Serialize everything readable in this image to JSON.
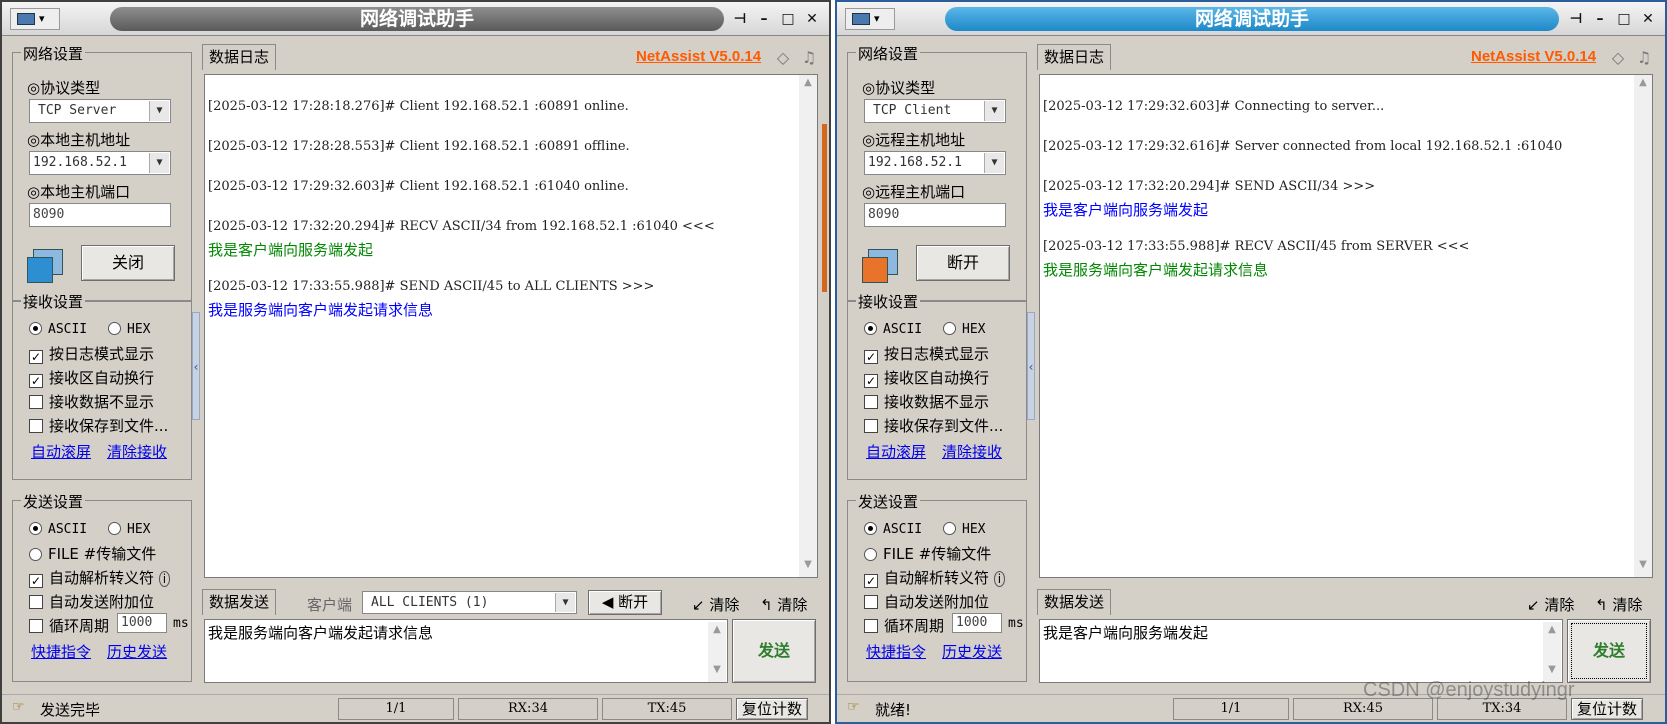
{
  "watermark": "CSDN @enjoystudyingr",
  "windows": [
    {
      "title": "网络调试助手",
      "network": {
        "group_title": "网络设置",
        "protocol_label": "◎协议类型",
        "protocol_value": "TCP Server",
        "host_label": "◎本地主机地址",
        "host_value": "192.168.52.1",
        "port_label": "◎本地主机端口",
        "port_value": "8090",
        "action_button": "关闭"
      },
      "receive": {
        "group_title": "接收设置",
        "ascii": "ASCII",
        "hex": "HEX",
        "opt1": "按日志模式显示",
        "opt2": "接收区自动换行",
        "opt3": "接收数据不显示",
        "opt4": "接收保存到文件...",
        "link1": "自动滚屏",
        "link2": "清除接收"
      },
      "send": {
        "group_title": "发送设置",
        "ascii": "ASCII",
        "hex": "HEX",
        "file": "FILE #传输文件",
        "opt1": "自动解析转义符",
        "opt2": "自动发送附加位",
        "opt3": "循环周期",
        "period": "1000",
        "unit": "ms",
        "link1": "快捷指令",
        "link2": "历史发送"
      },
      "log_tab": "数据日志",
      "brand": "NetAssist V5.0.14",
      "log": [
        {
          "head": "[2025-03-12 17:28:18.276]# Client 192.168.52.1 :60891 online."
        },
        {
          "head": "[2025-03-12 17:28:28.553]# Client 192.168.52.1 :60891 offline."
        },
        {
          "head": "[2025-03-12 17:29:32.603]# Client 192.168.52.1 :61040 online."
        },
        {
          "head": "[2025-03-12 17:32:20.294]# RECV ASCII/34 from 192.168.52.1 :61040 <<<",
          "msg": "我是客户端向服务端发起",
          "msg_color": "#008800"
        },
        {
          "head": "[2025-03-12 17:33:55.988]# SEND ASCII/45 to ALL CLIENTS >>>",
          "msg": "我是服务端向客户端发起请求信息",
          "msg_color": "#0000ff"
        }
      ],
      "send_tab": "数据发送",
      "client_label": "客户端",
      "client_value": "ALL CLIENTS (1)",
      "disconnect": "断开",
      "clear1": "清除",
      "clear2": "清除",
      "send_text": "我是服务端向客户端发起请求信息",
      "send_button": "发送",
      "status": {
        "text": "发送完毕",
        "page": "1/1",
        "rx": "RX:34",
        "tx": "TX:45",
        "reset": "复位计数"
      }
    },
    {
      "title": "网络调试助手",
      "network": {
        "group_title": "网络设置",
        "protocol_label": "◎协议类型",
        "protocol_value": "TCP Client",
        "host_label": "◎远程主机地址",
        "host_value": "192.168.52.1",
        "port_label": "◎远程主机端口",
        "port_value": "8090",
        "action_button": "断开"
      },
      "receive": {
        "group_title": "接收设置",
        "ascii": "ASCII",
        "hex": "HEX",
        "opt1": "按日志模式显示",
        "opt2": "接收区自动换行",
        "opt3": "接收数据不显示",
        "opt4": "接收保存到文件...",
        "link1": "自动滚屏",
        "link2": "清除接收"
      },
      "send": {
        "group_title": "发送设置",
        "ascii": "ASCII",
        "hex": "HEX",
        "file": "FILE #传输文件",
        "opt1": "自动解析转义符",
        "opt2": "自动发送附加位",
        "opt3": "循环周期",
        "period": "1000",
        "unit": "ms",
        "link1": "快捷指令",
        "link2": "历史发送"
      },
      "log_tab": "数据日志",
      "brand": "NetAssist V5.0.14",
      "log": [
        {
          "head": "[2025-03-12 17:29:32.603]# Connecting to server..."
        },
        {
          "head": "[2025-03-12 17:29:32.616]# Server connected from local 192.168.52.1 :61040"
        },
        {
          "head": "[2025-03-12 17:32:20.294]# SEND ASCII/34 >>>",
          "msg": "我是客户端向服务端发起",
          "msg_color": "#0000ff"
        },
        {
          "head": "[2025-03-12 17:33:55.988]# RECV ASCII/45 from SERVER <<<",
          "msg": "我是服务端向客户端发起请求信息",
          "msg_color": "#008800"
        }
      ],
      "send_tab": "数据发送",
      "clear1": "清除",
      "clear2": "清除",
      "send_text": "我是客户端向服务端发起",
      "send_button": "发送",
      "status": {
        "text": "就绪!",
        "page": "1/1",
        "rx": "RX:45",
        "tx": "TX:34",
        "reset": "复位计数"
      }
    }
  ]
}
